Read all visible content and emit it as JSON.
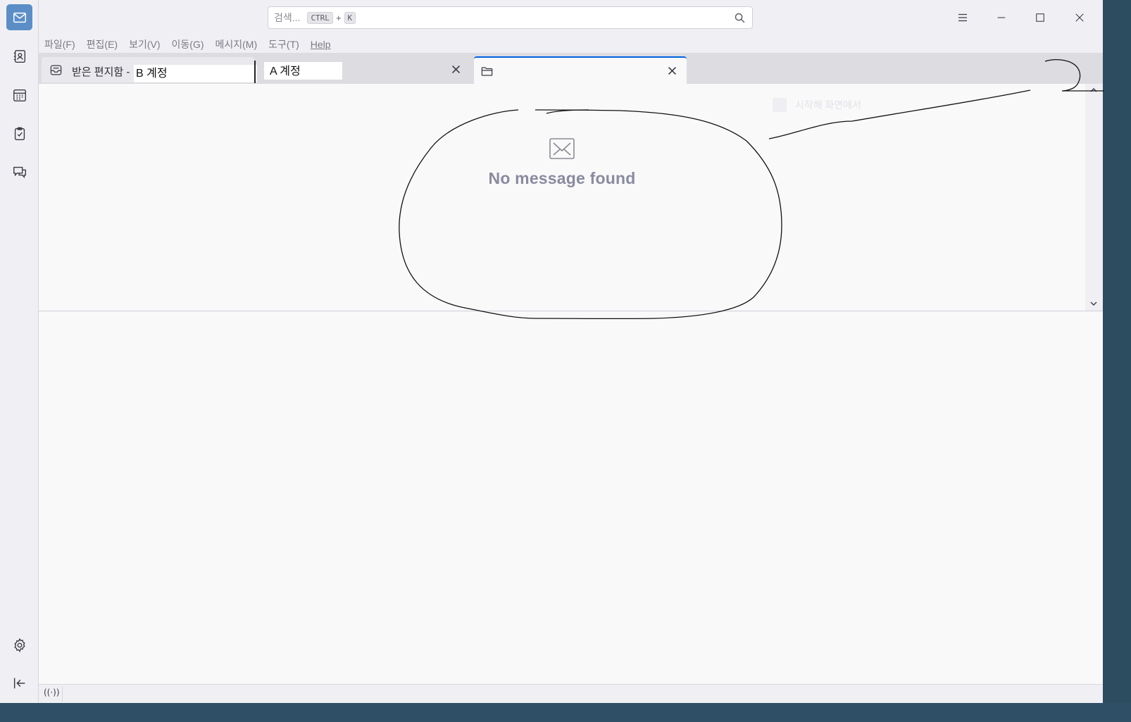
{
  "spaces": {
    "items": [
      {
        "name": "mail",
        "icon": "mail-icon",
        "active": true
      },
      {
        "name": "address-book",
        "icon": "address-book-icon"
      },
      {
        "name": "calendar",
        "icon": "calendar-icon"
      },
      {
        "name": "tasks",
        "icon": "tasks-icon"
      },
      {
        "name": "chat",
        "icon": "chat-icon"
      }
    ],
    "bottom": [
      {
        "name": "settings",
        "icon": "gear-icon"
      },
      {
        "name": "collapse",
        "icon": "collapse-icon"
      }
    ]
  },
  "search": {
    "placeholder": "검색...",
    "key1": "CTRL",
    "plus": "+",
    "key2": "K"
  },
  "menubar": {
    "file": "파일(F)",
    "edit": "편집(E)",
    "view": "보기(V)",
    "go": "이동(G)",
    "message": "메시지(M)",
    "tools": "도구(T)",
    "help": "Help"
  },
  "tabs": [
    {
      "label": "받은 편지함 -",
      "icon": "inbox-icon"
    },
    {
      "label": "",
      "icon": "folder-icon",
      "active": true
    }
  ],
  "overlays": {
    "b_account": "B 계정",
    "a_account": "A 계정"
  },
  "message_list": {
    "empty_text": "No message found",
    "faint_text": "시작해 화면에서"
  },
  "colors": {
    "accent": "#0060df",
    "mail_space_bg": "#5b8ec7",
    "empty_text": "#8a8aa0"
  }
}
